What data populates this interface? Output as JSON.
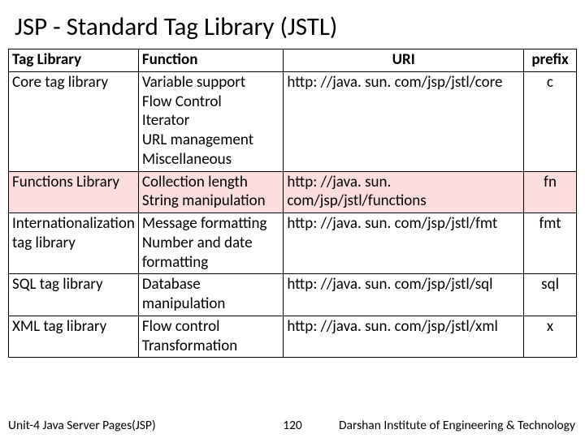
{
  "title": "JSP - Standard Tag Library (JSTL)",
  "headers": {
    "lib": "Tag Library",
    "func": "Function",
    "uri": "URI",
    "prefix": "prefix"
  },
  "rows": [
    {
      "lib": "Core tag library",
      "func": "Variable support\nFlow Control\nIterator\nURL management\nMiscellaneous",
      "uri": "http: //java. sun. com/jsp/jstl/core",
      "prefix": "c"
    },
    {
      "lib": "Functions Library",
      "func": "Collection length\nString manipulation",
      "uri": "http: //java. sun. com/jsp/jstl/functions",
      "prefix": "fn"
    },
    {
      "lib": "Internationalization tag library",
      "func": "Message formatting\nNumber and date formatting",
      "uri": "http: //java. sun. com/jsp/jstl/fmt",
      "prefix": "fmt"
    },
    {
      "lib": "SQL tag library",
      "func": "Database manipulation",
      "uri": "http: //java. sun. com/jsp/jstl/sql",
      "prefix": "sql"
    },
    {
      "lib": "XML tag library",
      "func": "Flow control\nTransformation",
      "uri": "http: //java. sun. com/jsp/jstl/xml",
      "prefix": "x"
    }
  ],
  "footer": {
    "left": "Unit-4 Java Server Pages(JSP)",
    "page": "120",
    "right": "Darshan Institute of Engineering & Technology"
  }
}
